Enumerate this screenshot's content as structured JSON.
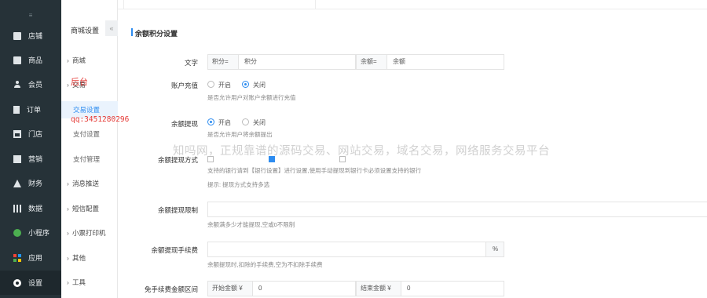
{
  "sidebar": {
    "top_glyph": "≡",
    "items": [
      {
        "label": "店铺",
        "icon": "store-icon"
      },
      {
        "label": "商品",
        "icon": "goods-icon"
      },
      {
        "label": "会员",
        "icon": "member-icon"
      },
      {
        "label": "订单",
        "icon": "order-icon"
      },
      {
        "label": "门店",
        "icon": "shop-icon"
      },
      {
        "label": "营销",
        "icon": "gift-icon"
      },
      {
        "label": "财务",
        "icon": "finance-icon"
      },
      {
        "label": "数据",
        "icon": "chart-icon"
      },
      {
        "label": "小程序",
        "icon": "miniapp-icon"
      },
      {
        "label": "应用",
        "icon": "apps-icon"
      },
      {
        "label": "设置",
        "icon": "gear-icon"
      }
    ]
  },
  "subnav": {
    "title": "商城设置",
    "collapse": "«",
    "items": [
      {
        "label": "商城"
      },
      {
        "label": "交易"
      },
      {
        "label": "交易设置"
      },
      {
        "label": "支付设置"
      },
      {
        "label": "支付管理"
      },
      {
        "label": "消息推送"
      },
      {
        "label": "短信配置"
      },
      {
        "label": "小票打印机"
      },
      {
        "label": "其他"
      },
      {
        "label": "工具"
      }
    ]
  },
  "main": {
    "section_title": "余额积分设置",
    "text_row": {
      "label": "文字",
      "addon1": "积分=",
      "value1": "积分",
      "addon2": "余额=",
      "value2": "余额"
    },
    "recharge": {
      "label": "账户充值",
      "opt_on": "开启",
      "opt_off": "关闭",
      "selected": "关闭",
      "help": "是否允许用户对账户余额进行充值"
    },
    "withdraw": {
      "label": "余额提现",
      "opt_on": "开启",
      "opt_off": "关闭",
      "selected": "开启",
      "help": "是否允许用户将余额提出"
    },
    "withdraw_method": {
      "label": "余额提现方式",
      "help1": "支持的银行请到【银行设置】进行设置,使用手动提现到银行卡必须设置支持的银行",
      "help2": "提示: 提现方式支持多选"
    },
    "withdraw_limit": {
      "label": "余额提现限制",
      "value": "",
      "help": "余额满多少才能提现,空或0不限制"
    },
    "withdraw_fee": {
      "label": "余额提现手续费",
      "value": "",
      "addon": "%",
      "help": "余额提现时,扣除的手续费,空为不扣除手续费"
    },
    "free_range": {
      "label": "免手续费金额区间",
      "start_addon": "开始金额 ¥",
      "start_value": "0",
      "end_addon": "结束金额 ¥",
      "end_value": "0"
    }
  },
  "overlay": {
    "watermark": "知吗网，正规靠谱的源码交易、网站交易，域名交易，网络服务交易平台",
    "red_text": "后台",
    "red_qq": "qq:3451280296"
  },
  "colors": {
    "sidebar_bg": "#263238",
    "accent": "#2d8cf0",
    "watermark_red": "#e53935"
  }
}
